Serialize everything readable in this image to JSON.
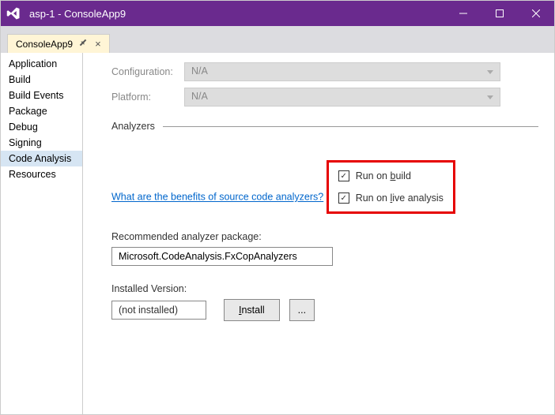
{
  "window": {
    "title": "asp-1 - ConsoleApp9"
  },
  "tab": {
    "name": "ConsoleApp9"
  },
  "sidebar": {
    "items": [
      {
        "label": "Application"
      },
      {
        "label": "Build"
      },
      {
        "label": "Build Events"
      },
      {
        "label": "Package"
      },
      {
        "label": "Debug"
      },
      {
        "label": "Signing"
      },
      {
        "label": "Code Analysis",
        "selected": true
      },
      {
        "label": "Resources"
      }
    ]
  },
  "config": {
    "configuration_label": "Configuration:",
    "configuration_value": "N/A",
    "platform_label": "Platform:",
    "platform_value": "N/A"
  },
  "analyzers": {
    "header": "Analyzers",
    "link": "What are the benefits of source code analyzers?",
    "run_on_build": {
      "checked": true,
      "prefix": "Run on ",
      "accel": "b",
      "suffix": "uild"
    },
    "run_on_live": {
      "checked": true,
      "prefix": "Run on ",
      "accel": "l",
      "suffix": "ive analysis"
    },
    "rec_label": "Recommended analyzer package:",
    "rec_value": "Microsoft.CodeAnalysis.FxCopAnalyzers",
    "installed_label": "Installed Version:",
    "installed_value": "(not installed)",
    "install_btn_prefix": "",
    "install_btn_accel": "I",
    "install_btn_suffix": "nstall",
    "browse_btn": "..."
  }
}
